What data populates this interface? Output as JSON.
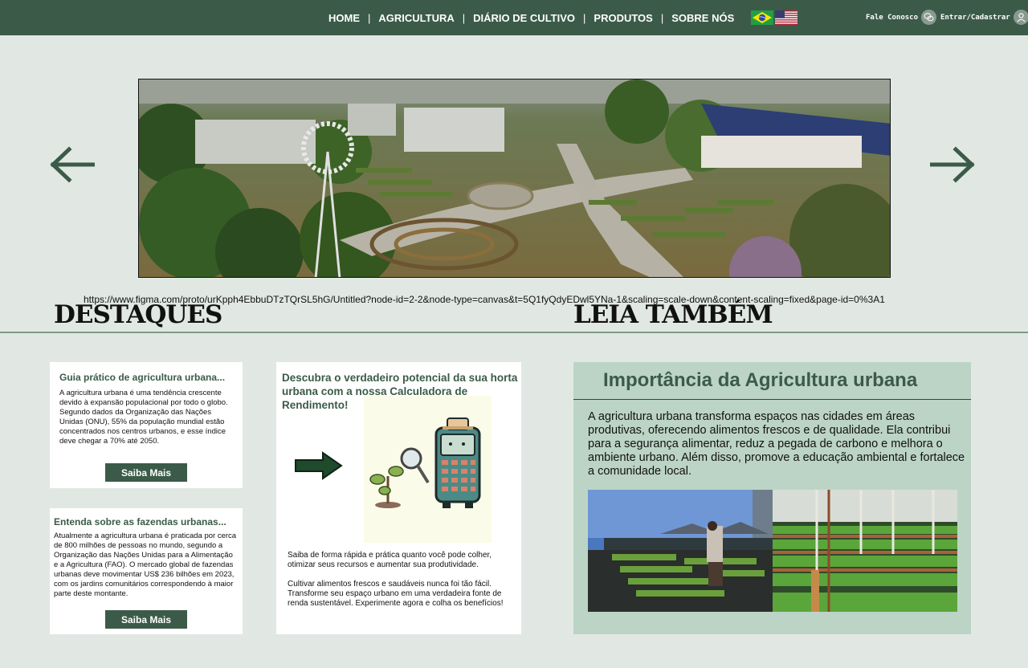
{
  "header": {
    "nav": [
      {
        "label": "HOME"
      },
      {
        "label": "AGRICULTURA"
      },
      {
        "label": "DIÁRIO DE CULTIVO"
      },
      {
        "label": "PRODUTOS"
      },
      {
        "label": "SOBRE NÓS"
      }
    ],
    "separator": "|",
    "contact_label": "Fale Conosco",
    "login_label": "Entrar/Cadastrar"
  },
  "hero": {
    "url_text": "https://www.figma.com/proto/urKpph4EbbuDTzTQrSL5hG/Untitled?node-id=2-2&node-type=canvas&t=5Q1fyQdyEDwl5YNa-1&scaling=scale-down&content-scaling=fixed&page-id=0%3A1"
  },
  "sections": {
    "destaques": "DESTAQUES",
    "leia": "LEIA TAMBÉM"
  },
  "cards": [
    {
      "title": "Guia prático de agricultura urbana...",
      "text": "A agricultura urbana é uma tendência crescente devido à expansão populacional por todo o globo. Segundo dados da Organização das Nações Unidas (ONU), 55% da população mundial estão concentrados nos centros urbanos, e esse índice deve chegar a 70% até 2050.",
      "button": "Saiba Mais"
    },
    {
      "title": "Entenda sobre as fazendas urbanas...",
      "text": "Atualmente a agricultura urbana é praticada por cerca de 800 milhões de pessoas no mundo, segundo a Organização das Nações Unidas para a Alimentação e a Agricultura (FAO). O mercado global de fazendas urbanas deve movimentar US$ 236 bilhões em 2023, com os jardins comunitários correspondendo à maior parte deste montante.",
      "button": "Saiba Mais"
    }
  ],
  "calculator": {
    "title": "Descubra o verdadeiro potencial da sua horta urbana com a nossa Calculadora de Rendimento!",
    "text1": "Saiba de forma rápida e prática quanto você pode colher, otimizar seus recursos e aumentar sua produtividade.",
    "text2": "Cultivar alimentos frescos e saudáveis nunca foi tão fácil. Transforme seu espaço urbano em uma verdadeira fonte de renda sustentável. Experimente agora e colha os benefícios!"
  },
  "leia": {
    "title": "Importância da Agricultura urbana",
    "text": "A agricultura urbana transforma espaços nas cidades em áreas produtivas, oferecendo alimentos frescos e de qualidade. Ela contribui para a segurança alimentar, reduz a pegada de carbono e melhora o ambiente urbano. Além disso, promove a educação ambiental e fortalece a comunidade local."
  },
  "colors": {
    "primary": "#3b5b48",
    "background": "#e1e8e3",
    "leia_bg": "#bcd4c5"
  }
}
